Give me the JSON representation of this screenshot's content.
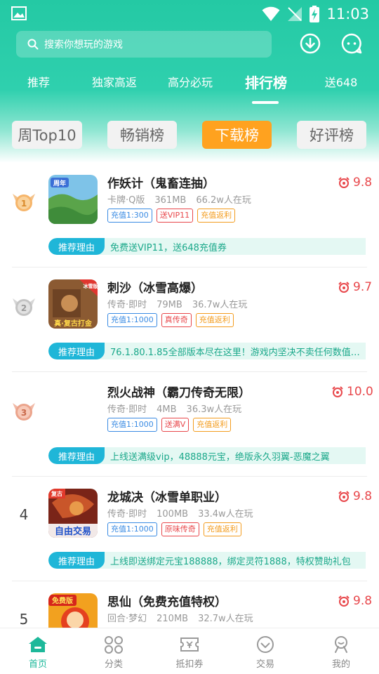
{
  "status_bar": {
    "time": "11:03"
  },
  "search": {
    "placeholder": "搜索你想玩的游戏"
  },
  "tabs": [
    {
      "label": "推荐"
    },
    {
      "label": "独家高返"
    },
    {
      "label": "高分必玩"
    },
    {
      "label": "排行榜",
      "active": true
    },
    {
      "label": "送648"
    }
  ],
  "subtabs": [
    {
      "label": "周Top10"
    },
    {
      "label": "畅销榜"
    },
    {
      "label": "下载榜",
      "active": true
    },
    {
      "label": "好评榜"
    }
  ],
  "reason_label": "推荐理由",
  "games": [
    {
      "rank": "1",
      "title": "作妖计（鬼畜连抽）",
      "genre": "卡牌·Q版",
      "size": "361MB",
      "players": "66.2w人在玩",
      "score": "9.8",
      "tags": [
        {
          "text": "充值1:300",
          "color": "blue"
        },
        {
          "text": "送VIP11",
          "color": "red"
        },
        {
          "text": "充值返利",
          "color": "orange"
        }
      ],
      "reason": "免费送VIP11，送648充值券",
      "icon_text": "周年"
    },
    {
      "rank": "2",
      "title": "刺沙（冰雪高爆）",
      "genre": "传奇·即时",
      "size": "79MB",
      "players": "36.7w人在玩",
      "score": "9.7",
      "tags": [
        {
          "text": "充值1:1000",
          "color": "blue"
        },
        {
          "text": "真传奇",
          "color": "red"
        },
        {
          "text": "充值返利",
          "color": "orange"
        }
      ],
      "reason": "76.1.80.1.85全部版本尽在这里！游戏内坚决不卖任何数值类装备",
      "icon_text": "真·复古打金",
      "icon_badge": "冰雪版"
    },
    {
      "rank": "3",
      "title": "烈火战神（霸刀传奇无限）",
      "genre": "传奇·即时",
      "size": "4MB",
      "players": "36.3w人在玩",
      "score": "10.0",
      "tags": [
        {
          "text": "充值1:1000",
          "color": "blue"
        },
        {
          "text": "送满V",
          "color": "red"
        },
        {
          "text": "充值返利",
          "color": "orange"
        }
      ],
      "reason": "上线送满级vip，48888元宝，绝版永久羽翼-恶魔之翼"
    },
    {
      "rank": "4",
      "title": "龙城决（冰雪单职业）",
      "genre": "传奇·即时",
      "size": "100MB",
      "players": "33.4w人在玩",
      "score": "9.8",
      "tags": [
        {
          "text": "充值1:1000",
          "color": "blue"
        },
        {
          "text": "原味传奇",
          "color": "red"
        },
        {
          "text": "充值返利",
          "color": "orange"
        }
      ],
      "reason": "上线即送绑定元宝188888，绑定灵符1888，特权赞助礼包",
      "icon_text": "自由交易",
      "icon_badge": "复古"
    },
    {
      "rank": "5",
      "title": "思仙（免费充值特权）",
      "genre": "回合·梦幻",
      "size": "210MB",
      "players": "32.7w人在玩",
      "score": "9.8",
      "tags": [],
      "reason": "",
      "icon_badge": "免费版"
    }
  ],
  "bottom_nav": [
    {
      "label": "首页",
      "active": true
    },
    {
      "label": "分类"
    },
    {
      "label": "抵扣券"
    },
    {
      "label": "交易"
    },
    {
      "label": "我的"
    }
  ],
  "colors": {
    "header": "#24c9a4",
    "accent_orange": "#ffa21f",
    "score_red": "#e8474b",
    "nav_active": "#1db89a"
  }
}
